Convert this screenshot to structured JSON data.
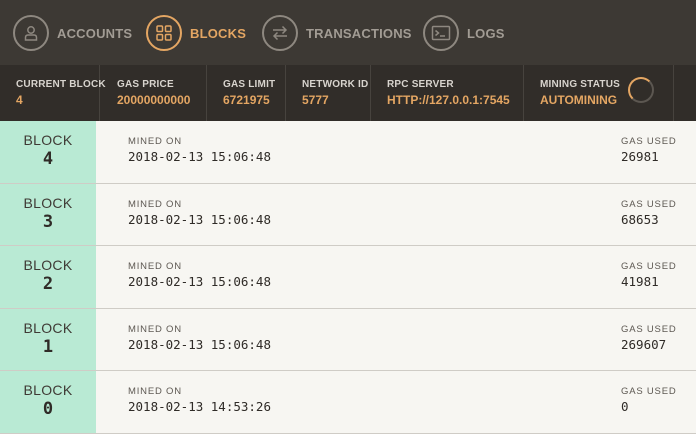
{
  "nav": {
    "items": [
      {
        "label": "ACCOUNTS",
        "icon": "person-icon",
        "active": false
      },
      {
        "label": "BLOCKS",
        "icon": "grid-icon",
        "active": true
      },
      {
        "label": "TRANSACTIONS",
        "icon": "swap-icon",
        "active": false
      },
      {
        "label": "LOGS",
        "icon": "terminal-icon",
        "active": false
      }
    ]
  },
  "status": {
    "current_block": {
      "label": "CURRENT BLOCK",
      "value": "4"
    },
    "gas_price": {
      "label": "GAS PRICE",
      "value": "20000000000"
    },
    "gas_limit": {
      "label": "GAS LIMIT",
      "value": "6721975"
    },
    "network_id": {
      "label": "NETWORK ID",
      "value": "5777"
    },
    "rpc_server": {
      "label": "RPC SERVER",
      "value": "HTTP://127.0.0.1:7545"
    },
    "mining_status": {
      "label": "MINING STATUS",
      "value": "AUTOMINING"
    }
  },
  "blocks": {
    "block_label": "BLOCK",
    "mined_label": "MINED ON",
    "gas_label": "GAS USED",
    "rows": [
      {
        "number": "4",
        "mined_on": "2018-02-13 15:06:48",
        "gas_used": "26981"
      },
      {
        "number": "3",
        "mined_on": "2018-02-13 15:06:48",
        "gas_used": "68653"
      },
      {
        "number": "2",
        "mined_on": "2018-02-13 15:06:48",
        "gas_used": "41981"
      },
      {
        "number": "1",
        "mined_on": "2018-02-13 15:06:48",
        "gas_used": "269607"
      },
      {
        "number": "0",
        "mined_on": "2018-02-13 14:53:26",
        "gas_used": "0"
      }
    ]
  },
  "colors": {
    "accent": "#e4a663",
    "nav_bg": "#3d3934",
    "status_bg": "#312d29",
    "block_badge": "#b9ead4"
  }
}
